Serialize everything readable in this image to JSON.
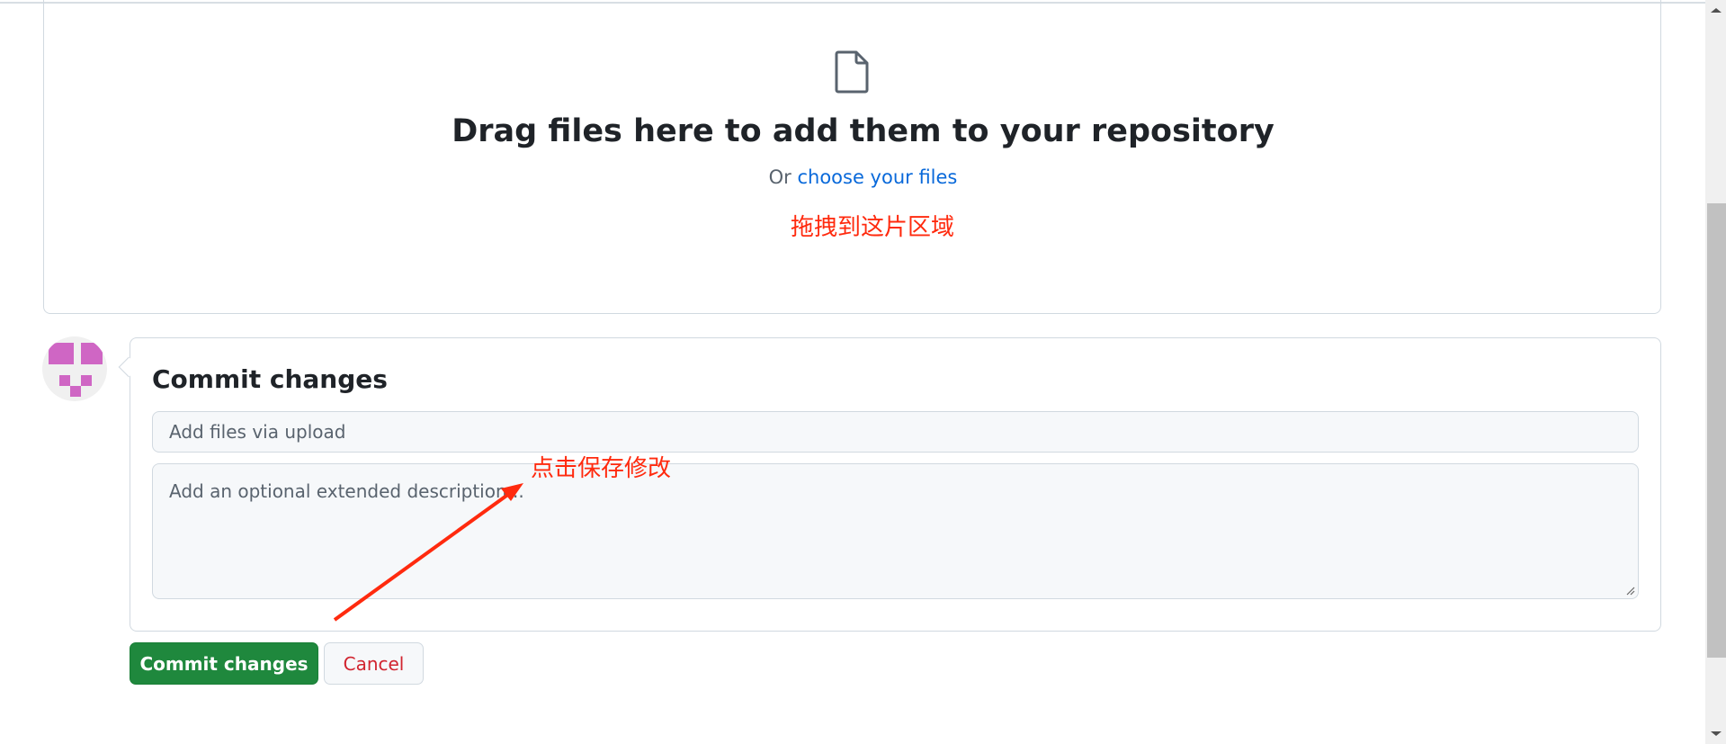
{
  "dropzone": {
    "title": "Drag files here to add them to your repository",
    "or_text": "Or",
    "choose_link": "choose your files",
    "annotation": "拖拽到这片区域"
  },
  "commit": {
    "title": "Commit changes",
    "summary_placeholder": "Add files via upload",
    "description_placeholder": "Add an optional extended description...",
    "annotation": "点击保存修改"
  },
  "buttons": {
    "commit": "Commit changes",
    "cancel": "Cancel"
  },
  "colors": {
    "accent_green": "#1f883d",
    "link": "#0969da",
    "annotation_red": "#ff2a0e",
    "avatar": "#cf66c4"
  }
}
